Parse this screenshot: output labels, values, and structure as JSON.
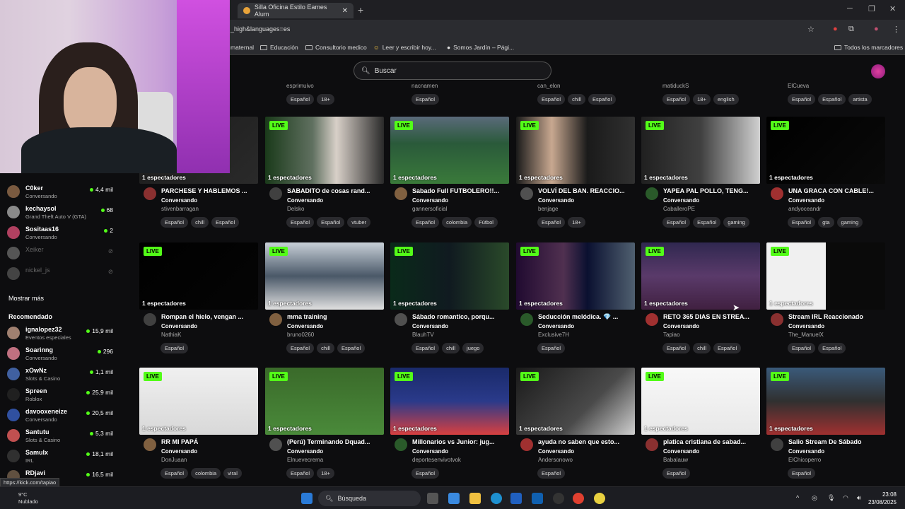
{
  "browser": {
    "tab_title": "Silla Oficina Estilo Eames Alum",
    "url": "_high&languages=es",
    "bookmarks": [
      "maternal",
      "Educación",
      "Consultorio medico",
      "Leer y escribir hoy...",
      "Somos Jardín – Pági...",
      "Todos los marcadores"
    ]
  },
  "search": {
    "placeholder": "Buscar"
  },
  "sidebar": {
    "following": [
      {
        "name": "C0ker",
        "sub": "Conversando",
        "viewers": "4,4 mil",
        "color": "#7a5a40"
      },
      {
        "name": "kechaysol",
        "sub": "Grand Theft Auto V (GTA)",
        "viewers": "68",
        "color": "#8a8a8a"
      },
      {
        "name": "Sositaas16",
        "sub": "Conversando",
        "viewers": "2",
        "color": "#b04060"
      },
      {
        "name": "Xeiker",
        "sub": "",
        "viewers": "",
        "color": "#555"
      },
      {
        "name": "nickel_js",
        "sub": "",
        "viewers": "",
        "color": "#444"
      }
    ],
    "show_more": "Mostrar más",
    "recommended_title": "Recomendado",
    "recommended": [
      {
        "name": "ignalopez32",
        "sub": "Eventos especiales",
        "viewers": "15,9 mil",
        "color": "#a08070"
      },
      {
        "name": "Soarinng",
        "sub": "Conversando",
        "viewers": "296",
        "color": "#c07080"
      },
      {
        "name": "xOwNz",
        "sub": "Slots & Casino",
        "viewers": "1,1 mil",
        "color": "#4060a0"
      },
      {
        "name": "Spreen",
        "sub": "Roblox",
        "viewers": "25,9 mil",
        "color": "#202020"
      },
      {
        "name": "davooxeneize",
        "sub": "Conversando",
        "viewers": "20,5 mil",
        "color": "#3050a0"
      },
      {
        "name": "Santutu",
        "sub": "Slots & Casino",
        "viewers": "5,3 mil",
        "color": "#c05050"
      },
      {
        "name": "Samulx",
        "sub": "IRL",
        "viewers": "18,1 mil",
        "color": "#303030"
      },
      {
        "name": "RDjavi",
        "sub": "Conversando",
        "viewers": "16,5 mil",
        "color": "#605040"
      }
    ]
  },
  "top_partial": [
    {
      "user": "esprimuivo",
      "tags": [
        "Español",
        "18+"
      ]
    },
    {
      "user": "nacnamen",
      "tags": [
        "Español"
      ]
    },
    {
      "user": "can_elon",
      "tags": [
        "Español",
        "chill",
        "Español"
      ]
    },
    {
      "user": "matiduckS",
      "tags": [
        "Español",
        "18+",
        "english"
      ]
    },
    {
      "user": "ElCueva",
      "tags": [
        "Español",
        "Español",
        "artista"
      ]
    }
  ],
  "live_label": "LIVE",
  "viewers_label": "1 espectadores",
  "category": "Conversando",
  "rows": [
    [
      {
        "title": "PARCHESE Y HABLEMOS ...",
        "user": "stivenbarragan",
        "tags": [
          "Español",
          "chill",
          "Español"
        ]
      },
      {
        "title": "SABADITO de cosas rand...",
        "user": "Delsko",
        "tags": [
          "Español",
          "Español",
          "vtuber"
        ]
      },
      {
        "title": "Sabado Full FUTBOLERO!!...",
        "user": "gannersoficial",
        "tags": [
          "Español",
          "colombia",
          "Fútbol"
        ]
      },
      {
        "title": "VOLVÍ DEL BAN. REACCIO...",
        "user": "benjage",
        "tags": [
          "Español",
          "18+"
        ]
      },
      {
        "title": "YAPEA PAL POLLO, TENG...",
        "user": "CaballeroPE",
        "tags": [
          "Español",
          "Español",
          "gaming"
        ]
      },
      {
        "title": "UNA GRACA CON CABLE!...",
        "user": "andyoceandr",
        "tags": [
          "Español",
          "gta",
          "gaming"
        ]
      }
    ],
    [
      {
        "title": "Rompan el hielo, vengan ...",
        "user": "NathiaK",
        "tags": [
          "Español"
        ]
      },
      {
        "title": "mma training",
        "user": "bruno0260",
        "tags": [
          "Español",
          "chill",
          "Español"
        ]
      },
      {
        "title": "Sábado romantico, porqu...",
        "user": "BlauhTV",
        "tags": [
          "Español",
          "chill",
          "juego"
        ]
      },
      {
        "title": "Seducción melódica. 💎 ...",
        "user": "Exclusive7H",
        "tags": [
          "Español"
        ]
      },
      {
        "title": "RETO 365 DIAS EN STREA...",
        "user": "Tapiao",
        "tags": [
          "Español",
          "chill",
          "Español"
        ]
      },
      {
        "title": "Stream IRL Reaccionado",
        "user": "The_ManuelX",
        "tags": [
          "Español",
          "Español"
        ]
      }
    ],
    [
      {
        "title": "RR MI PAPÁ",
        "user": "DonJuaan",
        "tags": [
          "Español",
          "colombia",
          "viral"
        ]
      },
      {
        "title": "(Perú) Terminando Dquad...",
        "user": "Elnuevecrema",
        "tags": [
          "Español",
          "18+"
        ]
      },
      {
        "title": "Millonarios vs Junior: jug...",
        "user": "deportesenvivotvok",
        "tags": [
          "Español"
        ]
      },
      {
        "title": "ayuda no saben que esto...",
        "user": "Andersonowo",
        "tags": [
          "Español"
        ]
      },
      {
        "title": "platica cristiana de sabad...",
        "user": "Babalauw",
        "tags": [
          "Español"
        ]
      },
      {
        "title": "Salio Stream De Sábado",
        "user": "ElChicoperro",
        "tags": [
          "Español"
        ]
      }
    ]
  ],
  "status_link": "https://kick.com/tapiao",
  "taskbar": {
    "search_placeholder": "Búsqueda",
    "weather_temp": "9°C",
    "weather_desc": "Nublado",
    "time": "23:08",
    "date": "23/08/2025"
  },
  "colors": {
    "accent": "#53fc18",
    "bg": "#0d0d0f"
  }
}
